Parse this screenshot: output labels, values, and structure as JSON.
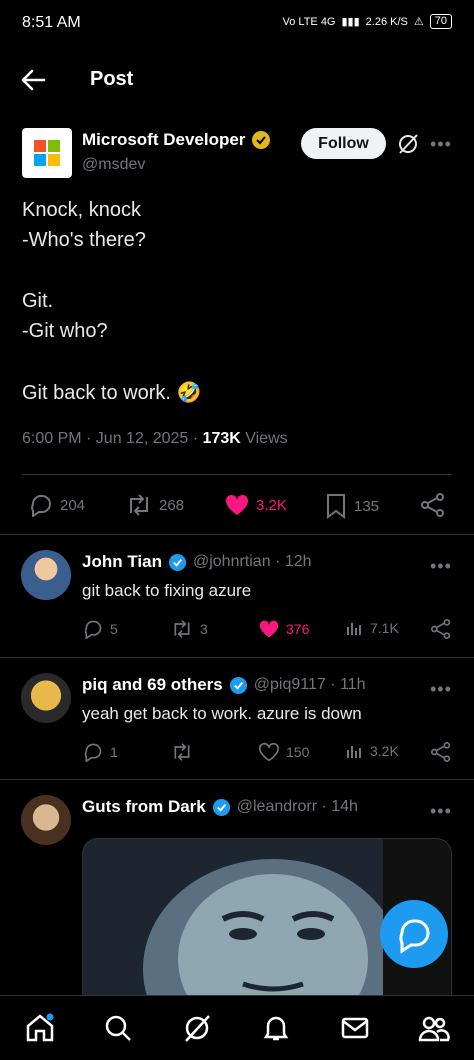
{
  "status_bar": {
    "time": "8:51 AM",
    "network": "Vo LTE 4G",
    "speed": "2.26 K/S",
    "battery": "70"
  },
  "header": {
    "title": "Post"
  },
  "post": {
    "author_name": "Microsoft Developer",
    "author_handle": "@msdev",
    "follow_label": "Follow",
    "lines": [
      "Knock, knock",
      "-Who's there?",
      "Git.",
      "-Git who?",
      "Git back to work. 🤣"
    ],
    "timestamp": "6:00 PM · Jun 12, 2025 · ",
    "views_count": "173K",
    "views_label": " Views",
    "stats": {
      "replies": "204",
      "reposts": "268",
      "likes": "3.2K",
      "bookmarks": "135"
    },
    "colors": {
      "like": "#f91880",
      "verified_gold": "#e2b719"
    }
  },
  "replies": [
    {
      "name": "John Tian",
      "handle": "@johnrtian · 12h",
      "text": "git back to fixing azure",
      "replies": "5",
      "reposts": "3",
      "likes": "376",
      "views": "7.1K",
      "liked": true
    },
    {
      "name": "piq and 69 others",
      "handle": "@piq9117 · 11h",
      "text": "yeah get back to work. azure is down",
      "replies": "1",
      "reposts": "",
      "likes": "150",
      "views": "3.2K",
      "liked": false
    },
    {
      "name": "Guts from Dark",
      "handle": "@leandrorr · 14h"
    }
  ],
  "nav": [
    "home-icon",
    "search-icon",
    "grok-icon",
    "notifications-icon",
    "messages-icon",
    "communities-icon"
  ]
}
